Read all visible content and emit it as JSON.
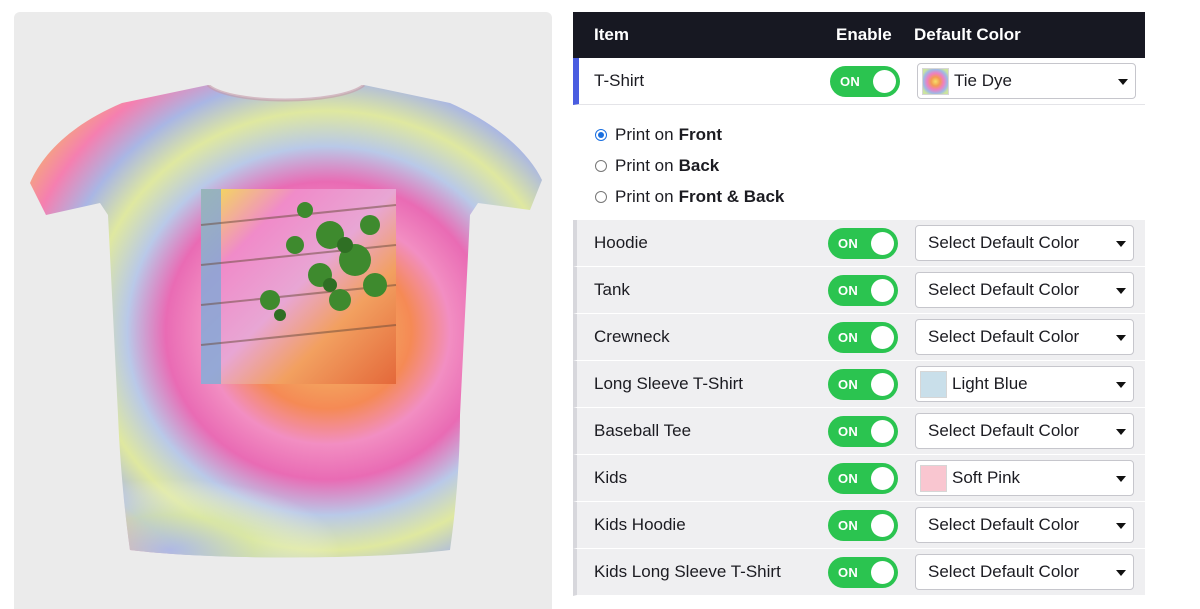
{
  "header": {
    "item": "Item",
    "enable": "Enable",
    "default_color": "Default Color"
  },
  "products": [
    {
      "name": "T-Shirt",
      "enabled": "ON",
      "color": "Tie Dye",
      "swatch": "tie-dye",
      "active": true
    },
    {
      "name": "Hoodie",
      "enabled": "ON",
      "color": "Select Default Color",
      "swatch": null
    },
    {
      "name": "Tank",
      "enabled": "ON",
      "color": "Select Default Color",
      "swatch": null
    },
    {
      "name": "Crewneck",
      "enabled": "ON",
      "color": "Select Default Color",
      "swatch": null
    },
    {
      "name": "Long Sleeve T-Shirt",
      "enabled": "ON",
      "color": "Light Blue",
      "swatch": "#c9dfea"
    },
    {
      "name": "Baseball Tee",
      "enabled": "ON",
      "color": "Select Default Color",
      "swatch": null
    },
    {
      "name": "Kids",
      "enabled": "ON",
      "color": "Soft Pink",
      "swatch": "#f9c6d0"
    },
    {
      "name": "Kids Hoodie",
      "enabled": "ON",
      "color": "Select Default Color",
      "swatch": null
    },
    {
      "name": "Kids Long Sleeve T-Shirt",
      "enabled": "ON",
      "color": "Select Default Color",
      "swatch": null
    }
  ],
  "print_options": [
    {
      "prefix": "Print on",
      "target": "Front",
      "checked": true
    },
    {
      "prefix": "Print on",
      "target": "Back",
      "checked": false
    },
    {
      "prefix": "Print on",
      "target": "Front & Back",
      "checked": false
    }
  ],
  "colors": {
    "header_bg": "#171822",
    "toggle_on": "#2bc450",
    "active_accent": "#4a5de0",
    "radio_accent": "#1a6fe0"
  },
  "preview": {
    "product_image": "tie-dye t-shirt with brick wall and plant print"
  }
}
